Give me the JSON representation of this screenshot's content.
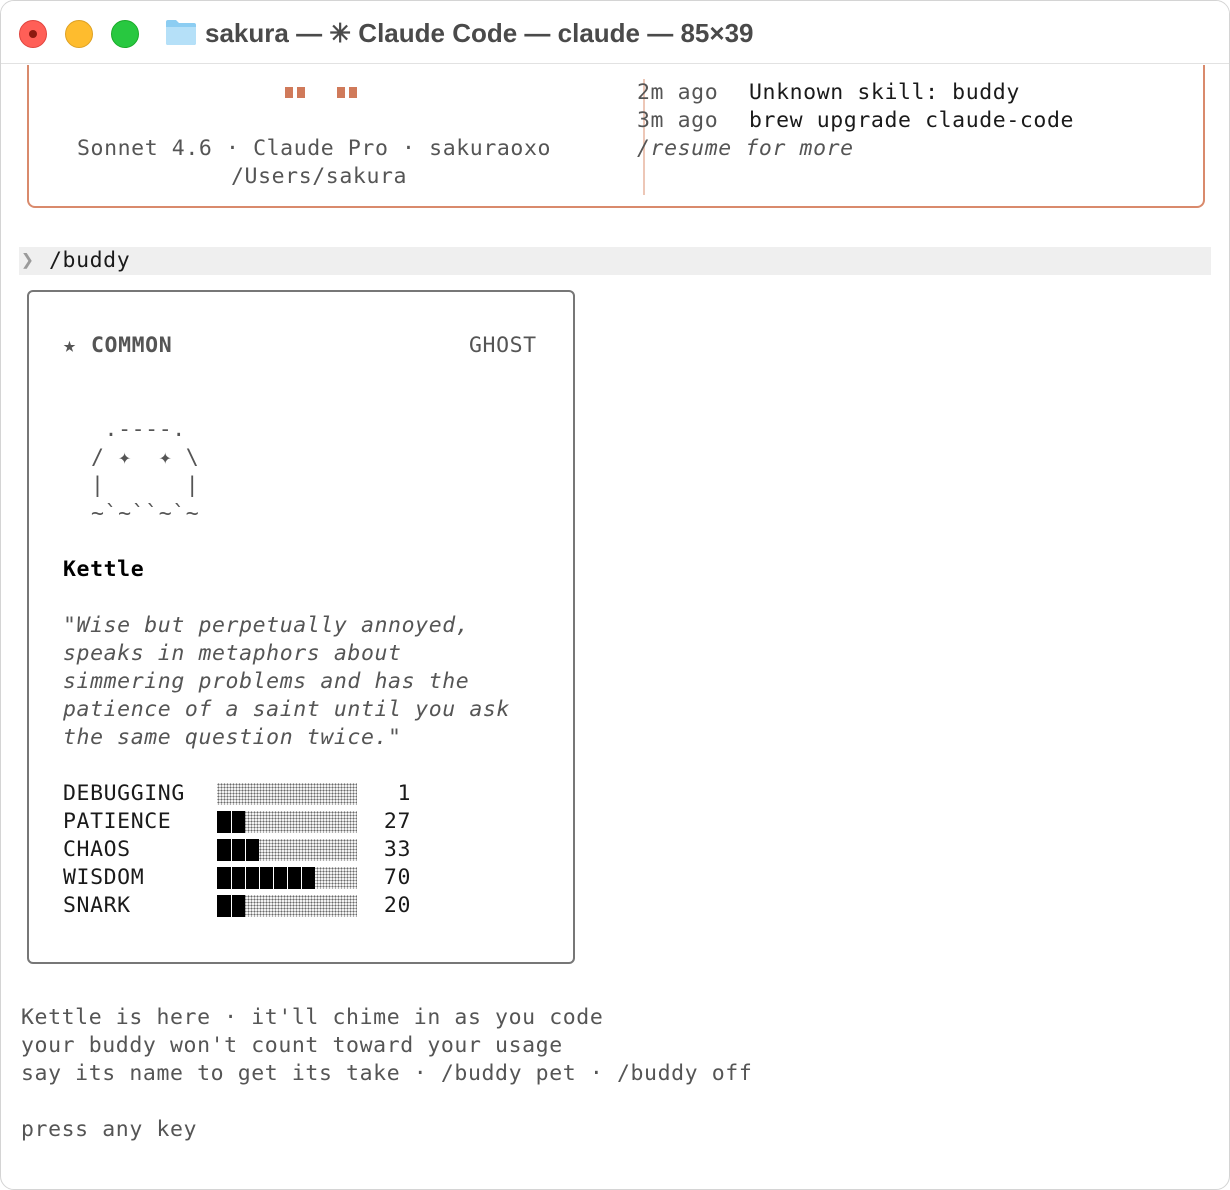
{
  "window": {
    "title": "sakura — ✳ Claude Code — claude — 85×39",
    "colors": {
      "close": "#ff5f57",
      "minimize": "#febc2e",
      "zoom": "#28c840",
      "accent": "#d98a6c"
    }
  },
  "welcome": {
    "model_line": "Sonnet 4.6 · Claude Pro · sakuraoxo",
    "cwd": "/Users/sakura",
    "recent": [
      {
        "time": "2m ago",
        "text": "Unknown skill: buddy"
      },
      {
        "time": "3m ago",
        "text": "brew upgrade claude-code"
      }
    ],
    "resume_hint": "/resume for more"
  },
  "prompt": {
    "chevron": "❯",
    "command": "/buddy"
  },
  "buddy": {
    "rarity_icon": "★",
    "rarity": "COMMON",
    "species": "GHOST",
    "art": [
      " .----.",
      "/ ✦  ✦ \\",
      "|      |",
      "~`~``~`~"
    ],
    "name": "Kettle",
    "quote": [
      "\"Wise but perpetually annoyed,",
      "speaks in metaphors about",
      "simmering problems and has the",
      "patience of a saint until you ask",
      "the same question twice.\""
    ],
    "stats": [
      {
        "name": "DEBUGGING",
        "value": 1
      },
      {
        "name": "PATIENCE",
        "value": 27
      },
      {
        "name": "CHAOS",
        "value": 33
      },
      {
        "name": "WISDOM",
        "value": 70
      },
      {
        "name": "SNARK",
        "value": 20
      }
    ]
  },
  "footer": {
    "lines": [
      "Kettle is here · it'll chime in as you code",
      "your buddy won't count toward your usage",
      "say its name to get its take · /buddy pet · /buddy off"
    ],
    "press_key": "press any key"
  }
}
